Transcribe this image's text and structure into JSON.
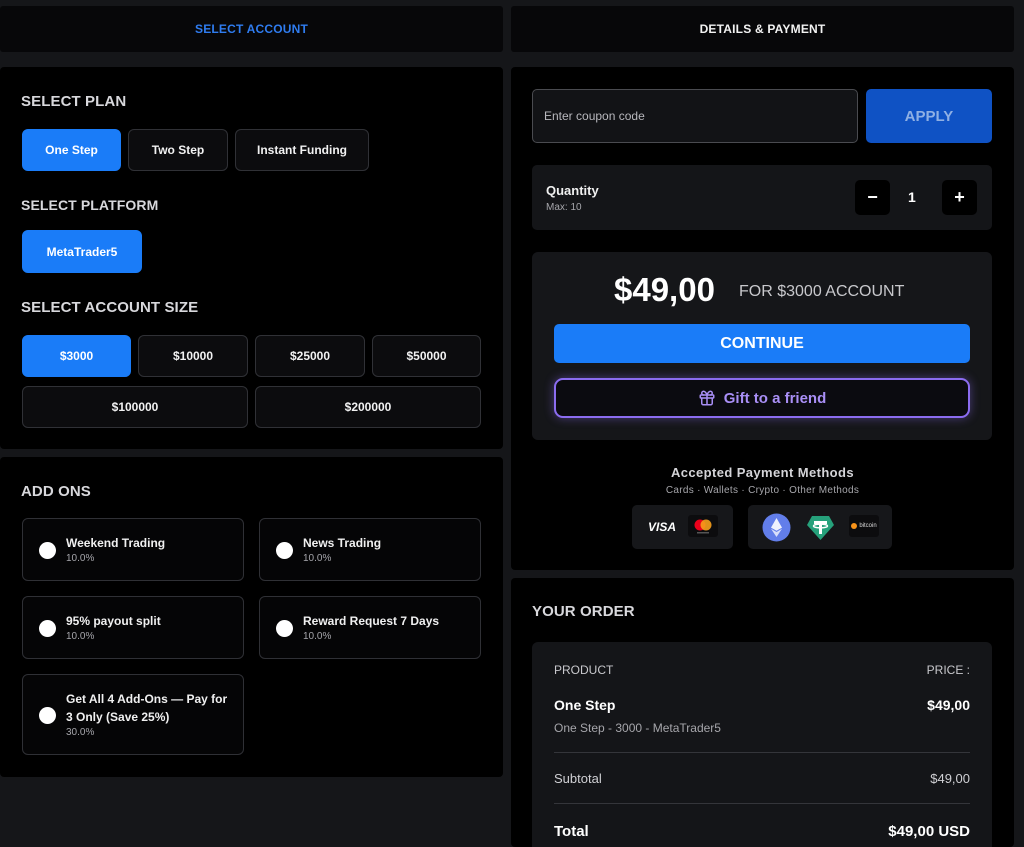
{
  "tabs": {
    "select_account": "SELECT ACCOUNT",
    "details_payment": "DETAILS & PAYMENT"
  },
  "plan": {
    "heading": "SELECT PLAN",
    "options": [
      "One Step",
      "Two Step",
      "Instant Funding"
    ],
    "selected": "One Step"
  },
  "platform": {
    "heading": "SELECT PLATFORM",
    "options": [
      "MetaTrader5"
    ],
    "selected": "MetaTrader5"
  },
  "account_size": {
    "heading": "SELECT ACCOUNT SIZE",
    "options": [
      "$3000",
      "$10000",
      "$25000",
      "$50000",
      "$100000",
      "$200000"
    ],
    "selected": "$3000"
  },
  "addons": {
    "heading": "ADD ONS",
    "items": [
      {
        "title": "Weekend Trading",
        "pct": "10.0%"
      },
      {
        "title": "News Trading",
        "pct": "10.0%"
      },
      {
        "title": "95% payout split",
        "pct": "10.0%"
      },
      {
        "title": "Reward Request 7 Days",
        "pct": "10.0%"
      },
      {
        "title_line1": "Get All 4 Add-Ons — Pay for",
        "title_line2": "3 Only (Save 25%)",
        "pct": "30.0%"
      }
    ]
  },
  "coupon": {
    "placeholder": "Enter coupon code",
    "apply_label": "APPLY"
  },
  "quantity": {
    "label": "Quantity",
    "max": "Max: 10",
    "minus": "−",
    "value": "1",
    "plus": "+"
  },
  "pricing": {
    "price": "$49,00",
    "for_text": "FOR $3000 ACCOUNT",
    "continue_label": "CONTINUE",
    "gift_label": "Gift to a friend"
  },
  "payment_methods": {
    "title": "Accepted Payment Methods",
    "subtitle": "Cards · Wallets · Crypto · Other Methods",
    "visa": "VISA",
    "bitcoin": "bitcoin"
  },
  "order": {
    "heading": "YOUR ORDER",
    "col_product": "PRODUCT",
    "col_price": "PRICE :",
    "product_name": "One Step",
    "product_price": "$49,00",
    "product_desc": "One Step - 3000 - MetaTrader5",
    "subtotal_label": "Subtotal",
    "subtotal_value": "$49,00",
    "total_label": "Total",
    "total_value": "$49,00 USD"
  },
  "colors": {
    "accent": "#1a7cf8",
    "gift_purple": "#8b6cf0",
    "apply_blue": "#0f52c4"
  }
}
